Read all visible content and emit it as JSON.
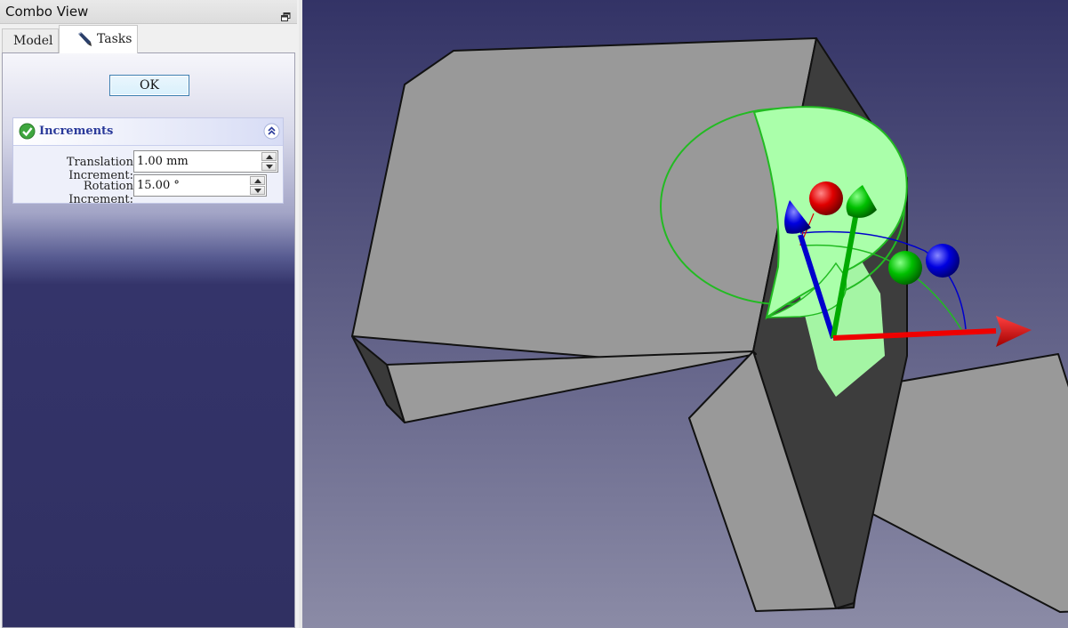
{
  "combo_view": {
    "title": "Combo View",
    "float_icon": "float-dock-icon",
    "tabs": [
      {
        "label": "Model",
        "active": false
      },
      {
        "label": "Tasks",
        "active": true,
        "icon": "pencil-icon"
      }
    ]
  },
  "task_panel": {
    "ok_label": "OK",
    "increments": {
      "title": "Increments",
      "icon": "check-icon",
      "collapse_icon": "collapse-icon",
      "translation_label": "Translation Increment:",
      "translation_value": "1.00 mm",
      "rotation_label": "Rotation Increment:",
      "rotation_value": "15.00 °"
    }
  },
  "viewport": {
    "background_top": "#333366",
    "background_bottom": "#8b8ba6",
    "part_color": "#999999",
    "dragger_colors": {
      "x": "#ff0000",
      "y": "#00aa00",
      "z": "#0000cc",
      "ring": "#aaffaa"
    }
  }
}
